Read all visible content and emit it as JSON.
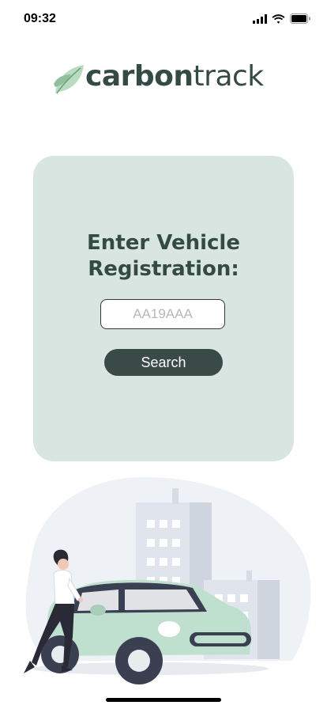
{
  "status_bar": {
    "time": "09:32",
    "icons": [
      "signal-icon",
      "wifi-icon",
      "battery-icon"
    ]
  },
  "logo": {
    "brand_bold": "carbon",
    "brand_light": "track",
    "icon": "leaf-icon"
  },
  "search_card": {
    "title_line1": "Enter Vehicle",
    "title_line2": "Registration:",
    "input_value": "",
    "input_placeholder": "AA19AAA",
    "button_label": "Search"
  },
  "colors": {
    "primary_dark": "#344a45",
    "card_background": "#d9e5e0",
    "button_background": "#3a4a46",
    "car_body": "#bfe0cf",
    "leaf_green": "#9ec9a9"
  }
}
